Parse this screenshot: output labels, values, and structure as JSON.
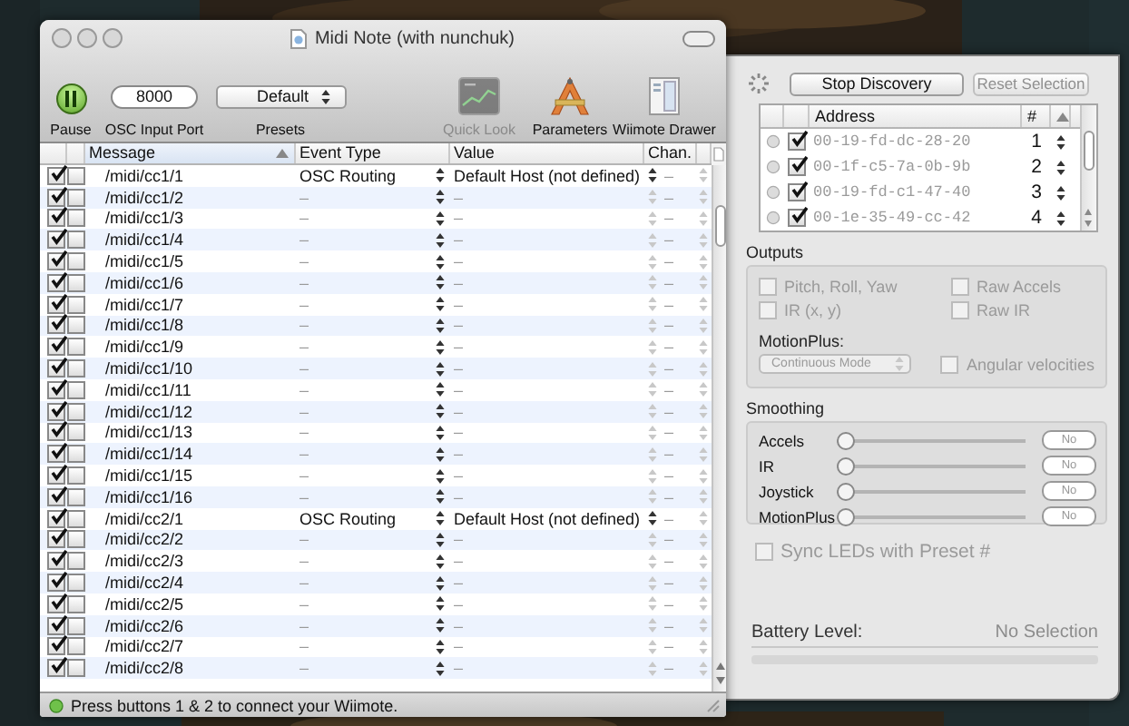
{
  "window": {
    "title": "Midi Note (with nunchuk)"
  },
  "toolbar": [
    {
      "kind": "pause",
      "label": "Pause",
      "disabled": false
    },
    {
      "kind": "field",
      "label": "OSC Input Port",
      "value": "8000",
      "disabled": false
    },
    {
      "kind": "popup",
      "label": "Presets",
      "value": "Default",
      "disabled": false
    },
    {
      "kind": "quicklook",
      "label": "Quick Look",
      "disabled": true
    },
    {
      "kind": "parameters",
      "label": "Parameters",
      "disabled": false
    },
    {
      "kind": "drawer",
      "label": "Wiimote Drawer",
      "disabled": false
    }
  ],
  "table": {
    "columns": [
      {
        "label": "Message",
        "sorted": true
      },
      {
        "label": "Event Type",
        "sorted": false
      },
      {
        "label": "Value",
        "sorted": false
      },
      {
        "label": "Chan.",
        "sorted": false
      }
    ],
    "rows": [
      {
        "kind": "routing",
        "enabled": true,
        "flag": false,
        "message": "/midi/cc1/1",
        "event_type": "OSC Routing",
        "value": "Default Host (not defined)",
        "channel": "–"
      },
      {
        "kind": "none",
        "enabled": true,
        "flag": false,
        "message": "/midi/cc1/2",
        "event_type": "–",
        "value": "–",
        "channel": "–"
      },
      {
        "kind": "none",
        "enabled": true,
        "flag": false,
        "message": "/midi/cc1/3",
        "event_type": "–",
        "value": "–",
        "channel": "–"
      },
      {
        "kind": "none",
        "enabled": true,
        "flag": false,
        "message": "/midi/cc1/4",
        "event_type": "–",
        "value": "–",
        "channel": "–"
      },
      {
        "kind": "none",
        "enabled": true,
        "flag": false,
        "message": "/midi/cc1/5",
        "event_type": "–",
        "value": "–",
        "channel": "–"
      },
      {
        "kind": "none",
        "enabled": true,
        "flag": false,
        "message": "/midi/cc1/6",
        "event_type": "–",
        "value": "–",
        "channel": "–"
      },
      {
        "kind": "none",
        "enabled": true,
        "flag": false,
        "message": "/midi/cc1/7",
        "event_type": "–",
        "value": "–",
        "channel": "–"
      },
      {
        "kind": "none",
        "enabled": true,
        "flag": false,
        "message": "/midi/cc1/8",
        "event_type": "–",
        "value": "–",
        "channel": "–"
      },
      {
        "kind": "none",
        "enabled": true,
        "flag": false,
        "message": "/midi/cc1/9",
        "event_type": "–",
        "value": "–",
        "channel": "–"
      },
      {
        "kind": "none",
        "enabled": true,
        "flag": false,
        "message": "/midi/cc1/10",
        "event_type": "–",
        "value": "–",
        "channel": "–"
      },
      {
        "kind": "none",
        "enabled": true,
        "flag": false,
        "message": "/midi/cc1/11",
        "event_type": "–",
        "value": "–",
        "channel": "–"
      },
      {
        "kind": "none",
        "enabled": true,
        "flag": false,
        "message": "/midi/cc1/12",
        "event_type": "–",
        "value": "–",
        "channel": "–"
      },
      {
        "kind": "none",
        "enabled": true,
        "flag": false,
        "message": "/midi/cc1/13",
        "event_type": "–",
        "value": "–",
        "channel": "–"
      },
      {
        "kind": "none",
        "enabled": true,
        "flag": false,
        "message": "/midi/cc1/14",
        "event_type": "–",
        "value": "–",
        "channel": "–"
      },
      {
        "kind": "none",
        "enabled": true,
        "flag": false,
        "message": "/midi/cc1/15",
        "event_type": "–",
        "value": "–",
        "channel": "–"
      },
      {
        "kind": "none",
        "enabled": true,
        "flag": false,
        "message": "/midi/cc1/16",
        "event_type": "–",
        "value": "–",
        "channel": "–"
      },
      {
        "kind": "routing",
        "enabled": true,
        "flag": false,
        "message": "/midi/cc2/1",
        "event_type": "OSC Routing",
        "value": "Default Host (not defined)",
        "channel": "–"
      },
      {
        "kind": "none",
        "enabled": true,
        "flag": false,
        "message": "/midi/cc2/2",
        "event_type": "–",
        "value": "–",
        "channel": "–"
      },
      {
        "kind": "none",
        "enabled": true,
        "flag": false,
        "message": "/midi/cc2/3",
        "event_type": "–",
        "value": "–",
        "channel": "–"
      },
      {
        "kind": "none",
        "enabled": true,
        "flag": false,
        "message": "/midi/cc2/4",
        "event_type": "–",
        "value": "–",
        "channel": "–"
      },
      {
        "kind": "none",
        "enabled": true,
        "flag": false,
        "message": "/midi/cc2/5",
        "event_type": "–",
        "value": "–",
        "channel": "–"
      },
      {
        "kind": "none",
        "enabled": true,
        "flag": false,
        "message": "/midi/cc2/6",
        "event_type": "–",
        "value": "–",
        "channel": "–"
      },
      {
        "kind": "none",
        "enabled": true,
        "flag": false,
        "message": "/midi/cc2/7",
        "event_type": "–",
        "value": "–",
        "channel": "–"
      },
      {
        "kind": "none",
        "enabled": true,
        "flag": false,
        "message": "/midi/cc2/8",
        "event_type": "–",
        "value": "–",
        "channel": "–"
      }
    ]
  },
  "status_bar": {
    "text": "Press buttons 1 & 2 to connect your Wiimote."
  },
  "drawer": {
    "buttons": [
      {
        "label": "Stop Discovery",
        "disabled": false
      },
      {
        "label": "Reset Selection",
        "disabled": true
      }
    ],
    "devices": {
      "columns": [
        {
          "label": "Address"
        },
        {
          "label": "#"
        }
      ],
      "rows": [
        {
          "connected": false,
          "checked": true,
          "address": "00-19-fd-dc-28-20",
          "number": "1"
        },
        {
          "connected": false,
          "checked": true,
          "address": "00-1f-c5-7a-0b-9b",
          "number": "2"
        },
        {
          "connected": false,
          "checked": true,
          "address": "00-19-fd-c1-47-40",
          "number": "3"
        },
        {
          "connected": false,
          "checked": true,
          "address": "00-1e-35-49-cc-42",
          "number": "4"
        }
      ]
    },
    "outputs": {
      "title": "Outputs",
      "options": [
        {
          "label": "Pitch, Roll, Yaw",
          "checked": false,
          "disabled": true
        },
        {
          "label": "Raw Accels",
          "checked": false,
          "disabled": true
        },
        {
          "label": "IR (x, y)",
          "checked": false,
          "disabled": true
        },
        {
          "label": "Raw IR",
          "checked": false,
          "disabled": true
        }
      ],
      "motionplus": {
        "label": "MotionPlus:",
        "mode": "Continuous Mode",
        "disabled": true
      },
      "angular": {
        "label": "Angular velocities",
        "checked": false,
        "disabled": true
      }
    },
    "smoothing": {
      "title": "Smoothing",
      "sliders": [
        {
          "label": "Accels",
          "level": 0,
          "reading": "No"
        },
        {
          "label": "IR",
          "level": 0,
          "reading": "No"
        },
        {
          "label": "Joystick",
          "level": 0,
          "reading": "No"
        },
        {
          "label": "MotionPlus",
          "level": 0,
          "reading": "No"
        }
      ]
    },
    "sync": {
      "label": "Sync LEDs with Preset #",
      "checked": false,
      "disabled": true
    },
    "battery": {
      "label": "Battery Level:",
      "reading": "No Selection",
      "level": 0
    }
  }
}
